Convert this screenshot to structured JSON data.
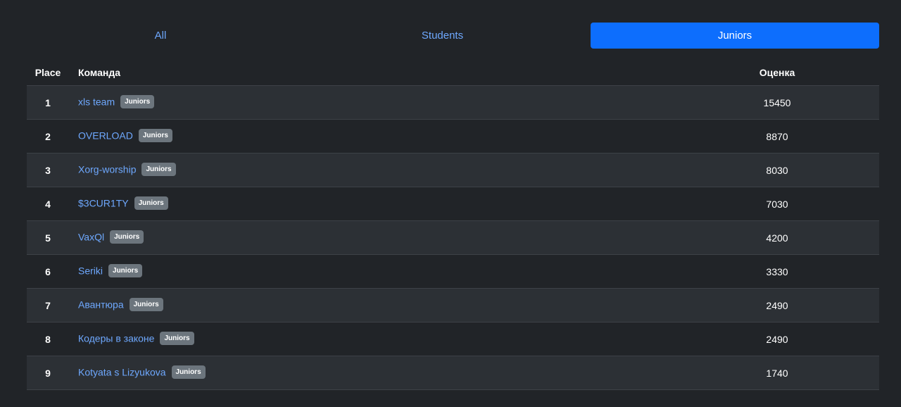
{
  "tabs": [
    {
      "label": "All",
      "active": false
    },
    {
      "label": "Students",
      "active": false
    },
    {
      "label": "Juniors",
      "active": true
    }
  ],
  "table": {
    "headers": {
      "place": "Place",
      "team": "Команда",
      "score": "Оценка"
    },
    "rows": [
      {
        "place": "1",
        "team": "xls team",
        "badge": "Juniors",
        "score": "15450"
      },
      {
        "place": "2",
        "team": "OVERLOAD",
        "badge": "Juniors",
        "score": "8870"
      },
      {
        "place": "3",
        "team": "Xorg-worship",
        "badge": "Juniors",
        "score": "8030"
      },
      {
        "place": "4",
        "team": "$3CUR1TY",
        "badge": "Juniors",
        "score": "7030"
      },
      {
        "place": "5",
        "team": "VaxQl",
        "badge": "Juniors",
        "score": "4200"
      },
      {
        "place": "6",
        "team": "Seriki",
        "badge": "Juniors",
        "score": "3330"
      },
      {
        "place": "7",
        "team": "Авантюра",
        "badge": "Juniors",
        "score": "2490"
      },
      {
        "place": "8",
        "team": "Кодеры в законе",
        "badge": "Juniors",
        "score": "2490"
      },
      {
        "place": "9",
        "team": "Kotyata s Lizyukova",
        "badge": "Juniors",
        "score": "1740"
      }
    ]
  },
  "colors": {
    "background": "#212428",
    "row_striped": "#2c3035",
    "link": "#6ea8fe",
    "active_tab": "#0d6efd",
    "badge": "#6c757d"
  }
}
